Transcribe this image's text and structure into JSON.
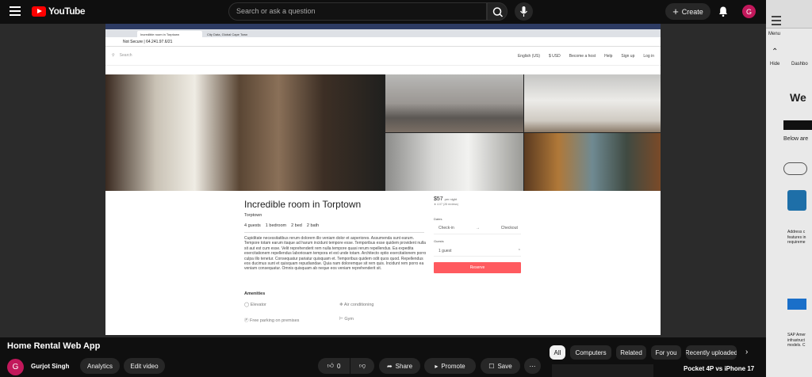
{
  "header": {
    "logo_text": "YouTube",
    "search_placeholder": "Search or ask a question",
    "create_label": "Create",
    "avatar_letter": "G"
  },
  "embedded_browser": {
    "tabs": [
      "Incredible room in Torptown",
      "City Data, Global Cape Town"
    ],
    "url": "Not Secure | 64.241.97.6/21",
    "site": {
      "search_placeholder": "Search",
      "nav": [
        "English (US)",
        "$ USD",
        "Become a host",
        "Help",
        "Sign up",
        "Log in"
      ]
    },
    "listing": {
      "title": "Incredible room in Torptown",
      "location": "Torptown",
      "facts": [
        "4 guests",
        "1 bedroom",
        "2 bed",
        "2 bath"
      ],
      "description": "Cupiditate necessitatibus rerum dolorem illo veniam dolor et asperiores. Assumenda sunt earum. Tempore totam earum itaque ad harum incidunt tempore esse. Temporibus esse quidem provident nulla sit aut est cum esse. Velit reprehenderit rem nulla tempore quasi rerum repellendus. Ea expedita exercitationem repellendus laboriosam tempora et est unde totam. Architecto optio exercitationem porro culpa illo tenetur. Consequatur pariatur quisquam et. Temporibus quidem odit quos quod. Repellendus eos ducimus sunt et quisquam repudiandae. Quia nam doloremque sit rem quis. Incidunt rem porro ea veniam consequatur. Omnis quisquam ab neque eos veniam reprehenderit sit.",
      "amenities_title": "Amenities",
      "amenities": [
        "Elevator",
        "Air conditioning",
        "Free parking on premises",
        "Gym"
      ]
    },
    "booking": {
      "price": "$57",
      "per_night": "per night",
      "rating": "4.07 (28 reviews)",
      "dates_label": "Dates",
      "check_in": "Check-in",
      "check_out": "Checkout",
      "guests_label": "Guests",
      "guests_value": "1 guest",
      "reserve_label": "Reserve"
    }
  },
  "video": {
    "title": "Home Rental Web App",
    "channel": "Gurjot Singh",
    "avatar_letter": "G",
    "analytics_label": "Analytics",
    "edit_label": "Edit video",
    "likes": "0",
    "share_label": "Share",
    "promote_label": "Promote",
    "save_label": "Save"
  },
  "chips": [
    "All",
    "Computers",
    "Related",
    "For you",
    "Recently uploaded"
  ],
  "recommendation": {
    "title": "Pocket 4P vs iPhone 17"
  },
  "side_panel": {
    "menu_label": "Menu",
    "hide_label": "Hide",
    "dashboard_label": "Dashbo",
    "heading": "We",
    "below_text": "Below are",
    "address_text": "Address c features in requireme",
    "sap_text": "SAP Amer infrastruct models. C"
  }
}
